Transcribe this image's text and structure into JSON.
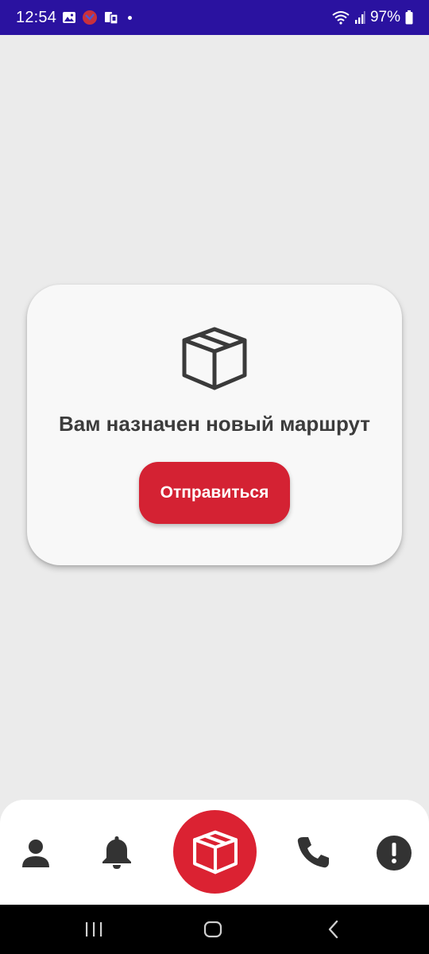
{
  "status_bar": {
    "time": "12:54",
    "battery": "97%",
    "icons": [
      "gallery-icon",
      "app-notification-icon",
      "sim-transfer-icon",
      "wifi-icon",
      "signal-icon",
      "battery-icon"
    ],
    "background": "#2a12a0"
  },
  "card": {
    "icon": "package-box-icon",
    "title": "Вам назначен новый маршрут",
    "button_label": "Отправиться",
    "accent": "#d42233"
  },
  "bottom_nav": {
    "items": [
      {
        "icon": "profile-icon"
      },
      {
        "icon": "bell-icon"
      },
      {
        "icon": "package-box-icon",
        "active": true
      },
      {
        "icon": "phone-icon"
      },
      {
        "icon": "alert-icon"
      }
    ],
    "accent": "#db2232"
  },
  "system_nav": {
    "buttons": [
      "recents-icon",
      "home-icon",
      "back-icon"
    ]
  }
}
